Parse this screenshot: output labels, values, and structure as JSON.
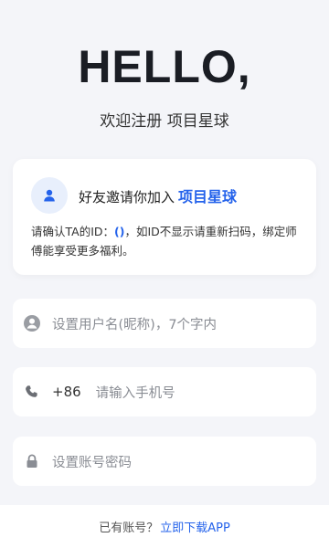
{
  "hero": {
    "title": "HELLO,",
    "subtitle": "欢迎注册 项目星球"
  },
  "invite": {
    "icon": "user-icon",
    "heading_prefix": "好友邀请你加入",
    "heading_project": "项目星球",
    "body_prefix": "请确认TA的ID：",
    "body_id": "()",
    "body_suffix": "，如ID不显示请重新扫码，绑定师傅能享受更多福利。"
  },
  "form": {
    "username_placeholder": "设置用户名(昵称)，7个字内",
    "country_code": "+86",
    "phone_placeholder": "请输入手机号",
    "password_placeholder": "设置账号密码"
  },
  "footer": {
    "prompt": "已有账号？",
    "link": "立即下载APP"
  },
  "colors": {
    "accent": "#2563eb",
    "background": "#f4f5f9",
    "icon_gray": "#8a8d94"
  }
}
